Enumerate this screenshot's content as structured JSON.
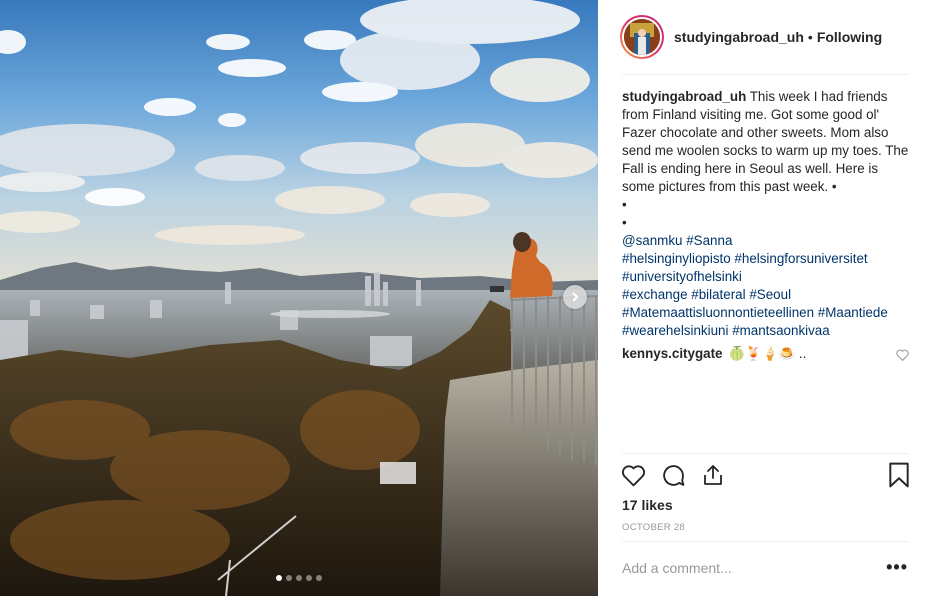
{
  "post": {
    "username": "studyingabroad_uh",
    "separator": "•",
    "follow_status": "Following",
    "caption_user": "studyingabroad_uh",
    "caption_text": "This week I had friends from Finland visiting me. Got some good ol' Fazer chocolate and other sweets. Mom also send me woolen socks to warm up my toes. The Fall is ending here in Seoul as well. Here is some pictures from this past week. •",
    "bullet_1": "•",
    "bullet_2": "•",
    "tags": [
      [
        "@sanmku",
        "#Sanna"
      ],
      [
        "#helsinginyliopisto",
        "#helsingforsuniversitet"
      ],
      [
        "#universityofhelsinki"
      ],
      [
        "#exchange",
        "#bilateral",
        "#Seoul"
      ],
      [
        "#Matemaattisluonnontieteellinen",
        "#Maantiede"
      ],
      [
        "#wearehelsinkiuni",
        "#mantsaonkivaa"
      ]
    ],
    "comment": {
      "user": "kennys.citygate",
      "text": "🍈🍹🍦🍮 .."
    },
    "likes": "17 likes",
    "date": "OCTOBER 28",
    "add_comment_placeholder": "Add a comment...",
    "more_label": "•••",
    "carousel": {
      "slides": 5,
      "active_index": 0
    }
  },
  "colors": {
    "link": "#003569",
    "meta": "#999999",
    "avatar_ring_start": "#f9a33a",
    "avatar_ring_end": "#c13584"
  },
  "icons": {
    "like": "heart-icon",
    "comment": "comment-icon",
    "share": "share-icon",
    "save": "bookmark-icon",
    "next": "chevron-right-icon"
  }
}
